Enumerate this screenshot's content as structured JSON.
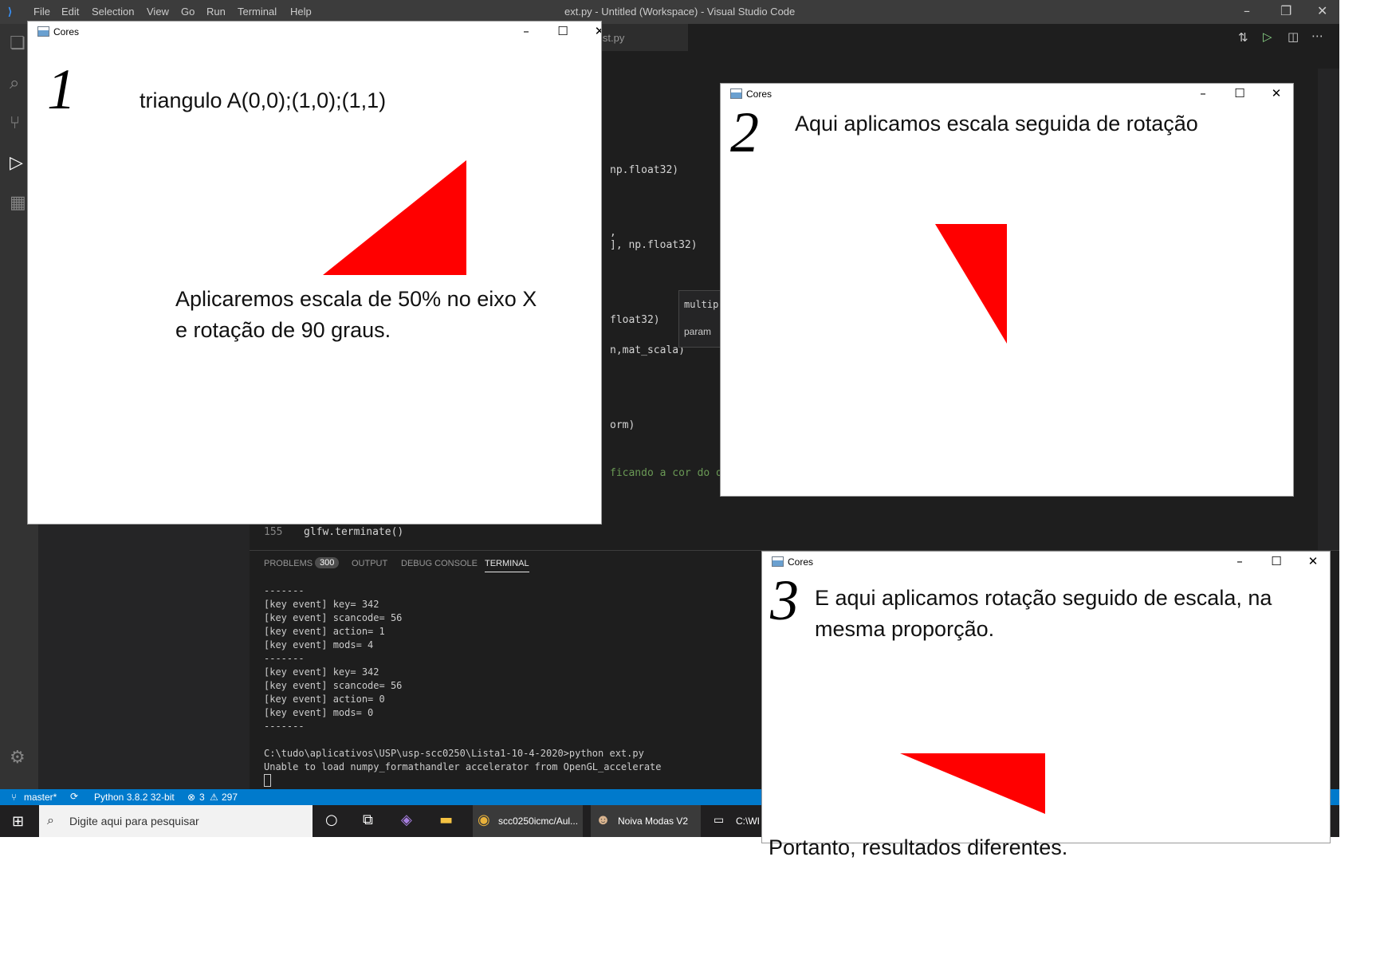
{
  "vscode": {
    "menu": [
      "File",
      "Edit",
      "Selection",
      "View",
      "Go",
      "Run",
      "Terminal",
      "Help"
    ],
    "window_title": "ext.py - Untitled (Workspace) - Visual Studio Code",
    "tab_fragment": "ist.py",
    "code_lines": {
      "l1": "np.float32)",
      "l2": ",",
      "l3": "], np.float32)",
      "l4": "float32)",
      "l5": "n,mat_scala)",
      "l6": "orm)",
      "l7": "ficando a cor do ob",
      "line_number": "155",
      "line_code": "glfw.terminate()"
    },
    "hover": {
      "line1": "multip",
      "line2": "param"
    },
    "panel_tabs": {
      "problems": "PROBLEMS",
      "problems_count": "300",
      "output": "OUTPUT",
      "debug": "DEBUG CONSOLE",
      "terminal": "TERMINAL"
    },
    "terminal_lines": [
      "-------",
      "[key event] key= 342",
      "[key event] scancode= 56",
      "[key event] action= 1",
      "[key event] mods= 4",
      "-------",
      "[key event] key= 342",
      "[key event] scancode= 56",
      "[key event] action= 0",
      "[key event] mods= 0",
      "-------",
      "",
      "C:\\tudo\\aplicativos\\USP\\usp-scc0250\\Lista1-10-4-2020>python ext.py",
      "Unable to load numpy_formathandler accelerator from OpenGL_accelerate"
    ],
    "status": {
      "branch": "master*",
      "python": "Python 3.8.2 32-bit",
      "errors": "3",
      "warnings": "297"
    }
  },
  "taskbar": {
    "search_placeholder": "Digite aqui para pesquisar",
    "apps": [
      "scc0250icmc/Aul...",
      "Noiva Modas V2",
      "C:\\WI"
    ]
  },
  "windows": [
    {
      "title": "Cores",
      "digit": "1",
      "note_a": "triangulo A(0,0);(1,0);(1,1)",
      "note_b": "Aplicaremos escala de 50% no eixo X",
      "note_c": "e rotação de 90 graus."
    },
    {
      "title": "Cores",
      "digit": "2",
      "note_a": "Aqui aplicamos escala seguida de rotação"
    },
    {
      "title": "Cores",
      "digit": "3",
      "note_a": "E aqui aplicamos rotação seguido de escala, na",
      "note_b": "mesma proporção."
    }
  ],
  "footer_note": "Portanto, resultados diferentes.",
  "colors": {
    "triangle": "#ff0000",
    "vscode_bg": "#1e1e1e",
    "status_bar": "#007acc"
  }
}
